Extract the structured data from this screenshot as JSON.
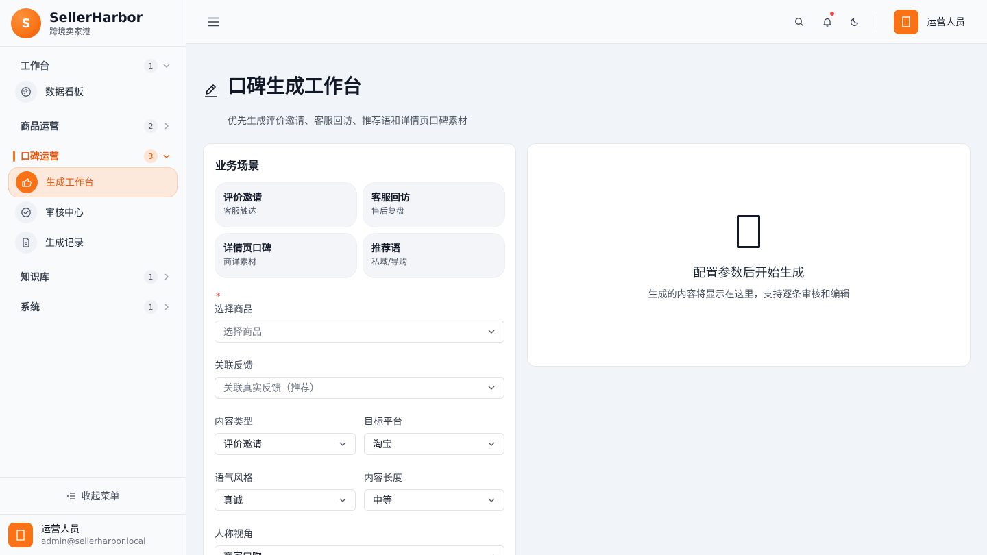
{
  "brand": {
    "logo_letter": "S",
    "name": "SellerHarbor",
    "subtitle": "跨境卖家港"
  },
  "sidebar": {
    "groups": [
      {
        "label": "工作台",
        "badge": "1"
      },
      {
        "label": "商品运营",
        "badge": "2"
      },
      {
        "label": "口碑运营",
        "badge": "3"
      },
      {
        "label": "知识库",
        "badge": "1"
      },
      {
        "label": "系统",
        "badge": "1"
      }
    ],
    "items": [
      {
        "label": "数据看板",
        "icon": "dashboard-icon"
      },
      {
        "label": "生成工作台",
        "icon": "thumbs-up-icon"
      },
      {
        "label": "审核中心",
        "icon": "check-circle-icon"
      },
      {
        "label": "生成记录",
        "icon": "document-icon"
      }
    ],
    "collapse_label": "收起菜单",
    "user": {
      "name": "运营人员",
      "email": "admin@sellerharbor.local"
    }
  },
  "header": {
    "user_name": "运营人员"
  },
  "page": {
    "title": "口碑生成工作台",
    "subtitle": "优先生成评价邀请、客服回访、推荐语和详情页口碑素材"
  },
  "form": {
    "section_title": "业务场景",
    "scenes": [
      {
        "title": "评价邀请",
        "sub": "客服触达"
      },
      {
        "title": "客服回访",
        "sub": "售后复盘"
      },
      {
        "title": "详情页口碑",
        "sub": "商详素材"
      },
      {
        "title": "推荐语",
        "sub": "私域/导购"
      }
    ],
    "required_mark": "*",
    "product_label": "选择商品",
    "product_placeholder": "选择商品",
    "feedback_label": "关联反馈",
    "feedback_placeholder": "关联真实反馈（推荐）",
    "content_type_label": "内容类型",
    "content_type_value": "评价邀请",
    "platform_label": "目标平台",
    "platform_value": "淘宝",
    "tone_label": "语气风格",
    "tone_value": "真诚",
    "length_label": "内容长度",
    "length_value": "中等",
    "perspective_label": "人称视角",
    "perspective_value": "商家口吻"
  },
  "result": {
    "empty_title": "配置参数后开始生成",
    "empty_sub": "生成的内容将显示在这里，支持逐条审核和编辑"
  },
  "colors": {
    "accent": "#f97316",
    "accent_dark": "#ea580c",
    "notify_dot": "#ef4444"
  }
}
